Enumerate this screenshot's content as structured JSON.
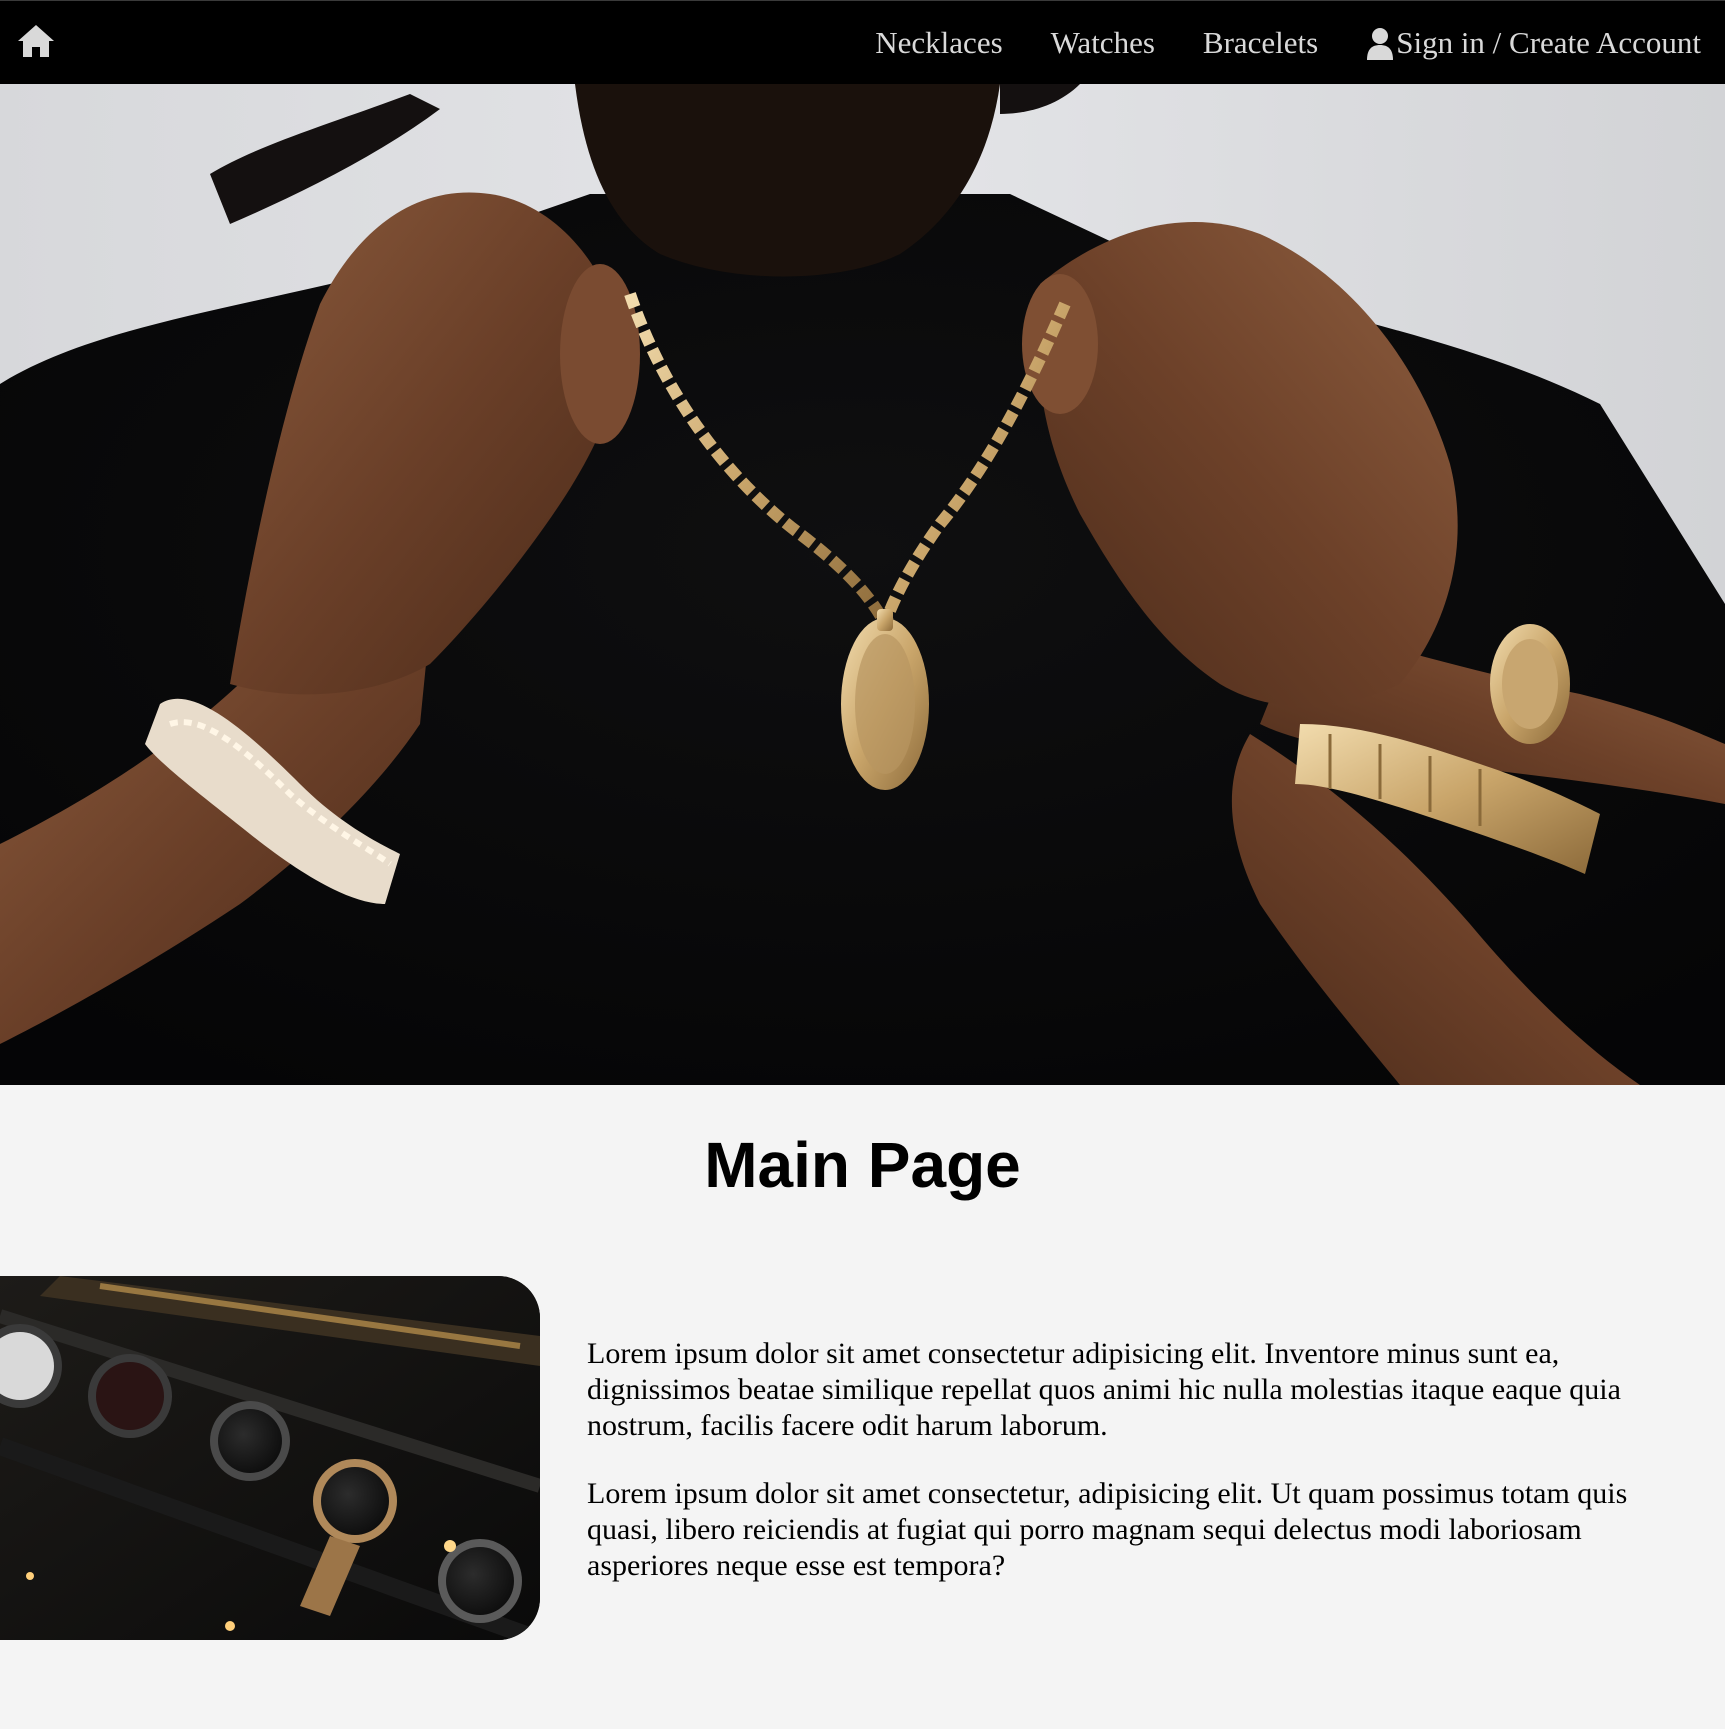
{
  "nav": {
    "home_icon": "home-icon",
    "links": [
      {
        "label": "Necklaces"
      },
      {
        "label": "Watches"
      },
      {
        "label": "Bracelets"
      }
    ],
    "account": {
      "icon": "user-icon",
      "label": "Sign in / Create Account"
    }
  },
  "hero": {
    "image_alt": "Person wearing gold chain necklace, bracelet and watch"
  },
  "main": {
    "title": "Main Page",
    "image_alt": "Watches in a display box",
    "paragraphs": [
      "Lorem ipsum dolor sit amet consectetur adipisicing elit. Inventore minus sunt ea, dignissimos beatae similique repellat quos animi hic nulla molestias itaque eaque quia nostrum, facilis facere odit harum laborum.",
      "Lorem ipsum dolor sit amet consectetur, adipisicing elit. Ut quam possimus totam quis quasi, libero reiciendis at fugiat qui porro magnam sequi delectus modi laboriosam asperiores neque esse est tempora?"
    ]
  },
  "colors": {
    "nav_background": "#000000",
    "nav_text": "#d9d9d9",
    "page_background": "#f4f4f4",
    "text": "#000000"
  }
}
